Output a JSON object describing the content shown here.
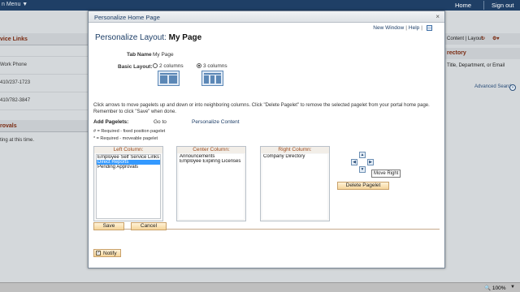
{
  "topbar": {
    "menu": "n Menu ▼",
    "home": "Home",
    "signout": "Sign out"
  },
  "bg_left": {
    "links_heading": "vice Links",
    "work_phone_label": "Work Phone",
    "phone1": "410/237-1723",
    "phone2": "410/782-3847",
    "approvals_heading": "rovals",
    "approvals_text": "ting at this time."
  },
  "bg_right": {
    "content_layout": "Content | Layout",
    "directory_heading": "rectory",
    "directory_desc": "Title, Department, or Email",
    "advanced_search": "Advanced Search"
  },
  "modal": {
    "title": "Personalize Home Page",
    "close": "×",
    "new_window": "New Window",
    "help": "Help",
    "heading_prefix": "Personalize Layout:",
    "heading_page": "My Page",
    "tab_name_label": "Tab Name",
    "tab_name_value": "My Page",
    "basic_layout_label": "Basic Layout:",
    "two_columns": "2 columns",
    "three_columns": "3 columns",
    "selected_layout": "3 columns",
    "instructions": "Click arrows to move pagelets up and down or into neighboring columns. Click \"Delete Pagelet\" to remove the selected pagelet from your portal home page. Remember to click \"Save\" when done.",
    "add_pagelets": "Add Pagelets:",
    "go_to": "Go to",
    "personalize_content": "Personalize Content",
    "legend_fixed": "# = Required - fixed position pagelet",
    "legend_moveable": "* = Required - moveable pagelet",
    "left_column": {
      "title": "Left Column:",
      "items": [
        "Employee Self Service Links",
        "Direct Reports",
        "Pending Approvals"
      ],
      "selected": "Direct Reports"
    },
    "center_column": {
      "title": "Center Column:",
      "items": [
        "Announcements",
        "Employee Expiring Licenses"
      ]
    },
    "right_column": {
      "title": "Right Column:",
      "items": [
        "Company Directory"
      ]
    },
    "move_right_tooltip": "Move Right",
    "delete_pagelet": "Delete Pagelet",
    "save": "Save",
    "cancel": "Cancel",
    "notify": "Notify"
  },
  "statusbar": {
    "zoom": "100%"
  },
  "colors": {
    "title_blue": "#1d3e67",
    "column_heading": "#9c4a1c",
    "selection": "#3399ff",
    "topbar": "#1f3f66"
  }
}
